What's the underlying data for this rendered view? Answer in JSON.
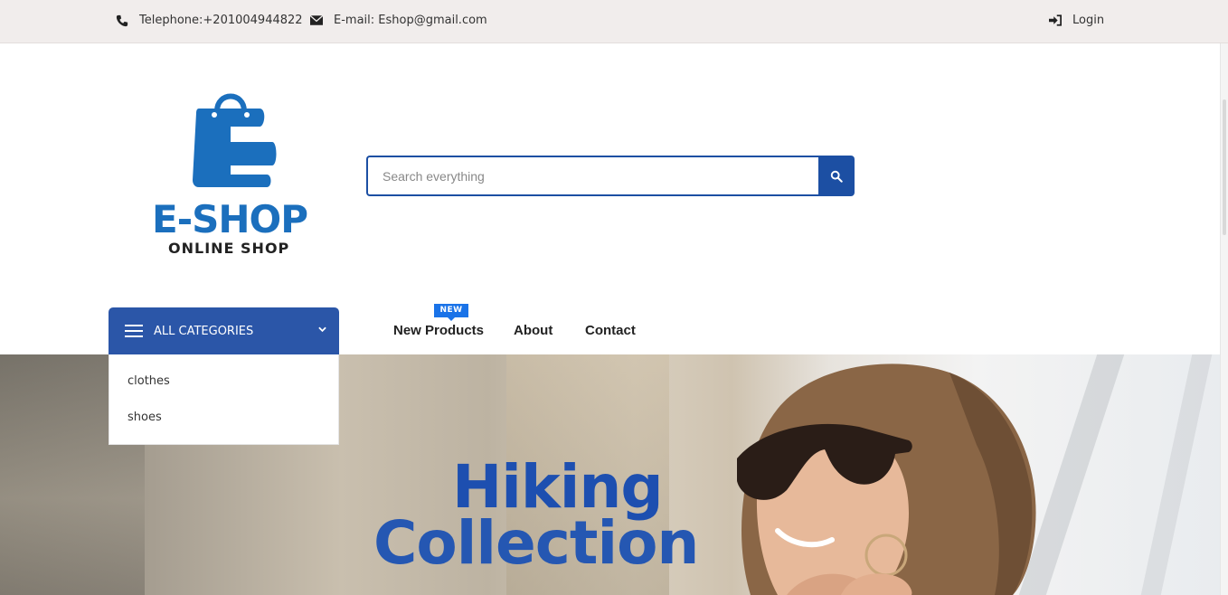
{
  "topbar": {
    "phone": "Telephone:+201004944822",
    "email": "E-mail: Eshop@gmail.com",
    "login": "Login"
  },
  "logo": {
    "word": "E-SHOP",
    "sub": "ONLINE SHOP"
  },
  "search": {
    "placeholder": "Search everything"
  },
  "categories": {
    "label": "ALL CATEGORIES",
    "items": [
      "clothes",
      "shoes"
    ]
  },
  "nav": {
    "badge": "NEW",
    "items": [
      "New Products",
      "About",
      "Contact"
    ]
  },
  "hero": {
    "line1": "Hiking",
    "line2": "Collection"
  },
  "colors": {
    "brand": "#1b6fbd",
    "accent": "#1c4fa3",
    "category_header": "#2b56a8",
    "badge": "#1a73e8"
  },
  "icons": [
    "phone-icon",
    "envelope-icon",
    "login-icon",
    "search-icon",
    "menu-icon",
    "chevron-down-icon",
    "shopping-bag-logo"
  ]
}
